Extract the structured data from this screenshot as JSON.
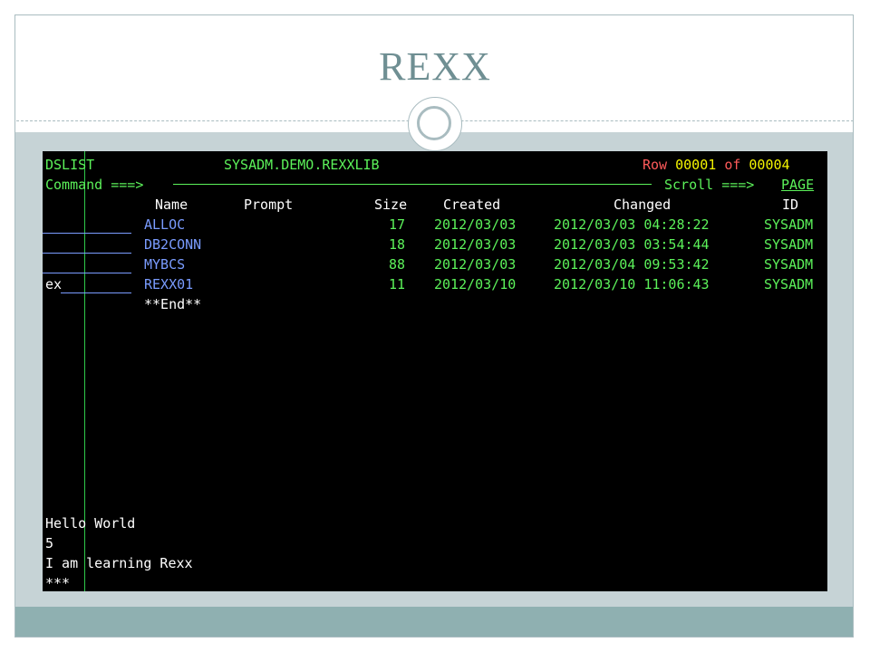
{
  "slide": {
    "title": "REXX"
  },
  "terminal": {
    "panel_name": "DSLIST",
    "dataset_level": "SYSADM.DEMO.REXXLIB",
    "row_label": "Row",
    "row_current": "00001",
    "row_of": "of",
    "row_total": "00004",
    "command_prompt": "Command ===>",
    "command_value": "",
    "scroll_label": "Scroll ===>",
    "scroll_value": "PAGE",
    "columns": {
      "name": "Name",
      "prompt": "Prompt",
      "size": "Size",
      "created": "Created",
      "changed": "Changed",
      "id": "ID"
    },
    "members": [
      {
        "cmd": "",
        "name": "ALLOC",
        "size": "17",
        "created": "2012/03/03",
        "changed": "2012/03/03 04:28:22",
        "id": "SYSADM"
      },
      {
        "cmd": "",
        "name": "DB2CONN",
        "size": "18",
        "created": "2012/03/03",
        "changed": "2012/03/03 03:54:44",
        "id": "SYSADM"
      },
      {
        "cmd": "",
        "name": "MYBCS",
        "size": "88",
        "created": "2012/03/03",
        "changed": "2012/03/04 09:53:42",
        "id": "SYSADM"
      },
      {
        "cmd": "ex",
        "name": "REXX01",
        "size": "11",
        "created": "2012/03/10",
        "changed": "2012/03/10 11:06:43",
        "id": "SYSADM"
      }
    ],
    "end_marker": "**End**",
    "output_lines": [
      "Hello World",
      "5",
      "I am learning Rexx",
      "***"
    ],
    "colors": {
      "background": "#000000",
      "green": "#5cf25a",
      "blue": "#7a9cff",
      "white": "#ffffff",
      "yellow": "#f4f400"
    }
  }
}
